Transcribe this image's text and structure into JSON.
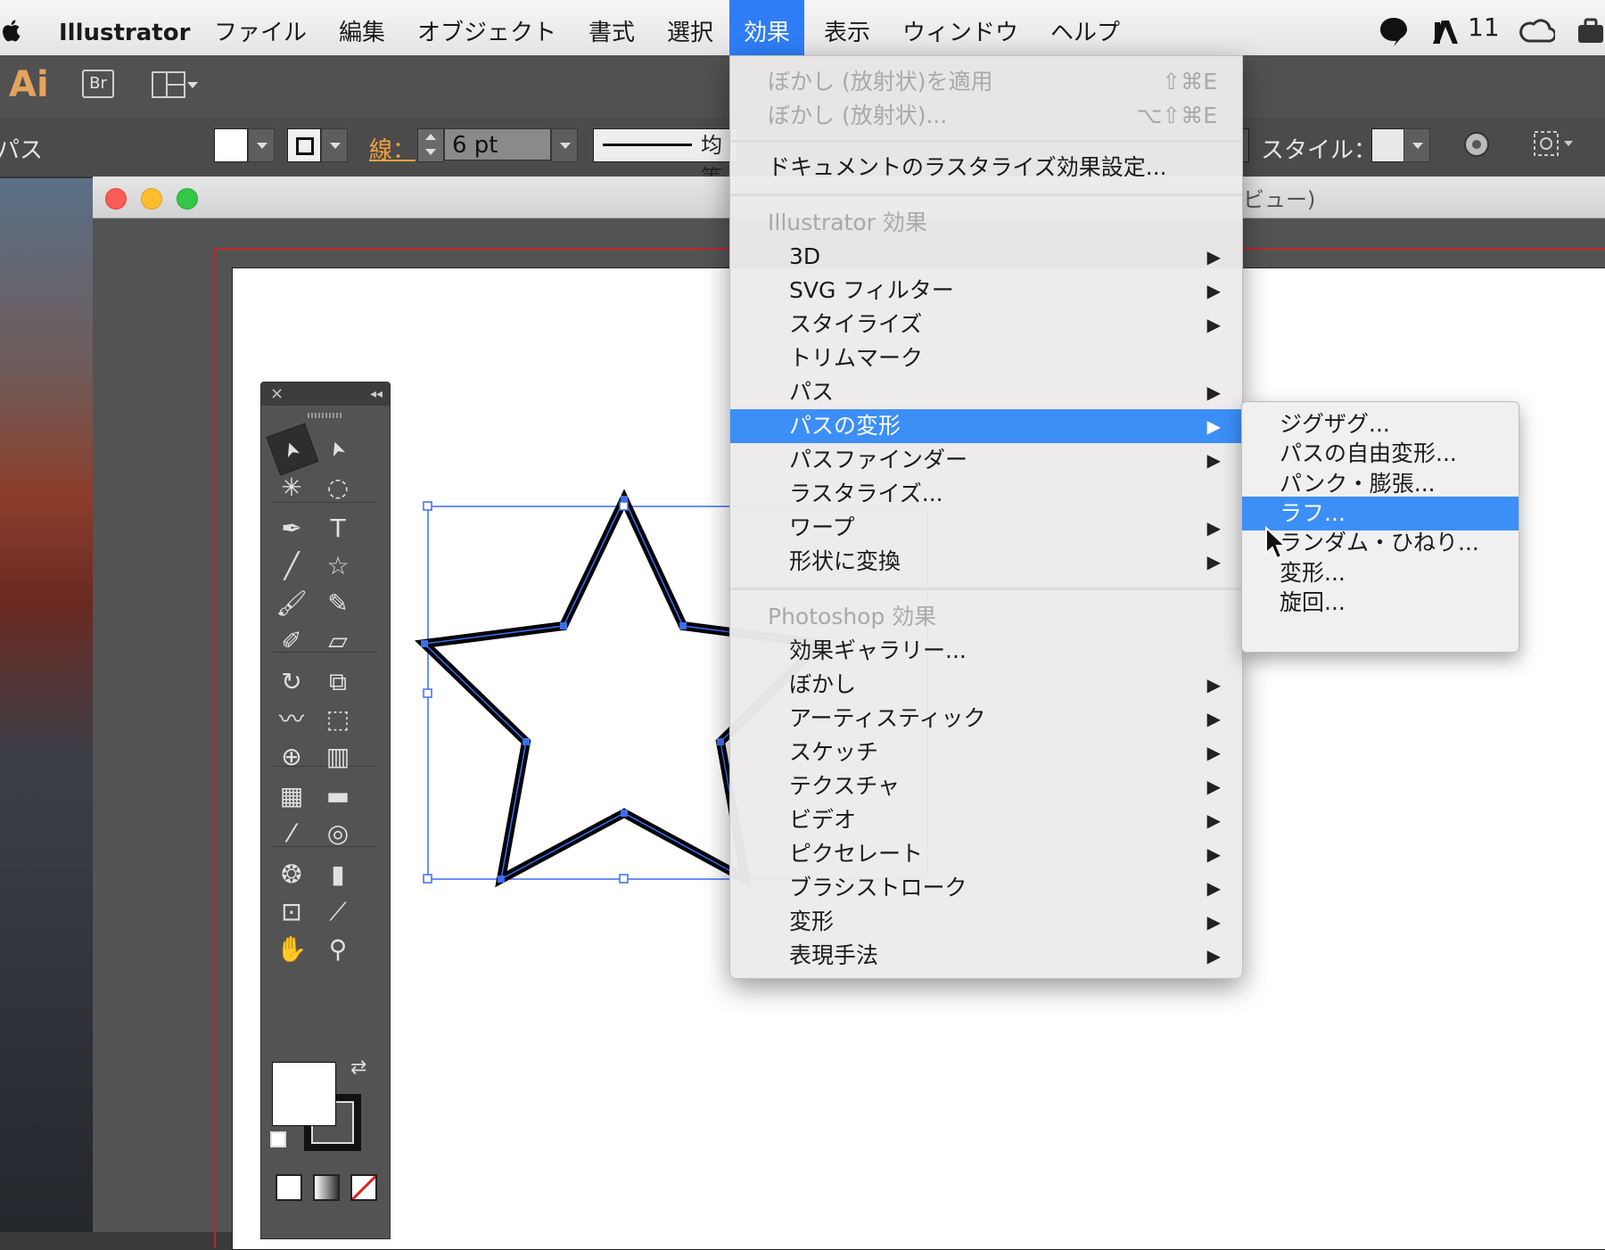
{
  "menubar": {
    "app_name": "Illustrator",
    "items": [
      "ファイル",
      "編集",
      "オブジェクト",
      "書式",
      "選択",
      "効果",
      "表示",
      "ウィンドウ",
      "ヘルプ"
    ],
    "active_item": "効果",
    "status_number": "11"
  },
  "toolbar": {
    "app_logo": "Ai",
    "bridge_label": "Br"
  },
  "control_bar": {
    "selection_type": "パス",
    "stroke_label": "線：",
    "stroke_weight": "6 pt",
    "profile_label": "均等",
    "style_label": "スタイル："
  },
  "document": {
    "title_fragment": "ビュー)"
  },
  "effect_menu": {
    "items": [
      {
        "label": "ぼかし (放射状)を適用",
        "shortcut": "⇧⌘E",
        "state": "disabled"
      },
      {
        "label": "ぼかし (放射状)...",
        "shortcut": "⌥⇧⌘E",
        "state": "disabled"
      },
      {
        "label": "ドキュメントのラスタライズ効果設定...",
        "state": "normal"
      },
      {
        "label": "Illustrator 効果",
        "state": "header"
      },
      {
        "label": "3D",
        "submenu": true
      },
      {
        "label": "SVG フィルター",
        "submenu": true
      },
      {
        "label": "スタイライズ",
        "submenu": true
      },
      {
        "label": "トリムマーク"
      },
      {
        "label": "パス",
        "submenu": true
      },
      {
        "label": "パスの変形",
        "submenu": true,
        "state": "highlighted"
      },
      {
        "label": "パスファインダー",
        "submenu": true
      },
      {
        "label": "ラスタライズ..."
      },
      {
        "label": "ワープ",
        "submenu": true
      },
      {
        "label": "形状に変換",
        "submenu": true
      },
      {
        "label": "Photoshop 効果",
        "state": "header"
      },
      {
        "label": "効果ギャラリー..."
      },
      {
        "label": "ぼかし",
        "submenu": true
      },
      {
        "label": "アーティスティック",
        "submenu": true
      },
      {
        "label": "スケッチ",
        "submenu": true
      },
      {
        "label": "テクスチャ",
        "submenu": true
      },
      {
        "label": "ビデオ",
        "submenu": true
      },
      {
        "label": "ピクセレート",
        "submenu": true
      },
      {
        "label": "ブラシストローク",
        "submenu": true
      },
      {
        "label": "変形",
        "submenu": true
      },
      {
        "label": "表現手法",
        "submenu": true
      }
    ]
  },
  "distort_submenu": {
    "items": [
      "ジグザグ...",
      "パスの自由変形...",
      "パンク・膨張...",
      "ラフ...",
      "ランダム・ひねり...",
      "変形...",
      "旋回..."
    ],
    "highlighted": "ラフ..."
  },
  "tools_panel": {
    "close_glyph": "×",
    "collapse_glyph": "◂◂",
    "tool_icons": [
      "selection-arrow-icon",
      "direct-selection-icon",
      "magic-wand-icon",
      "lasso-icon",
      "pen-icon",
      "type-icon",
      "line-icon",
      "star-icon",
      "paintbrush-icon",
      "pencil-icon",
      "blob-brush-icon",
      "eraser-icon",
      "rotate-icon",
      "scale-icon",
      "warp-icon",
      "free-transform-icon",
      "shape-builder-icon",
      "perspective-grid-icon",
      "mesh-icon",
      "gradient-icon",
      "eyedropper-icon",
      "blend-icon",
      "symbol-sprayer-icon",
      "graph-icon",
      "artboard-icon",
      "slice-icon",
      "hand-icon",
      "zoom-icon"
    ]
  },
  "colors": {
    "accent": "#3c8ff7",
    "ai_logo": "#e4a45c",
    "bleed": "#c0272d",
    "selection": "#3d6ef0"
  }
}
